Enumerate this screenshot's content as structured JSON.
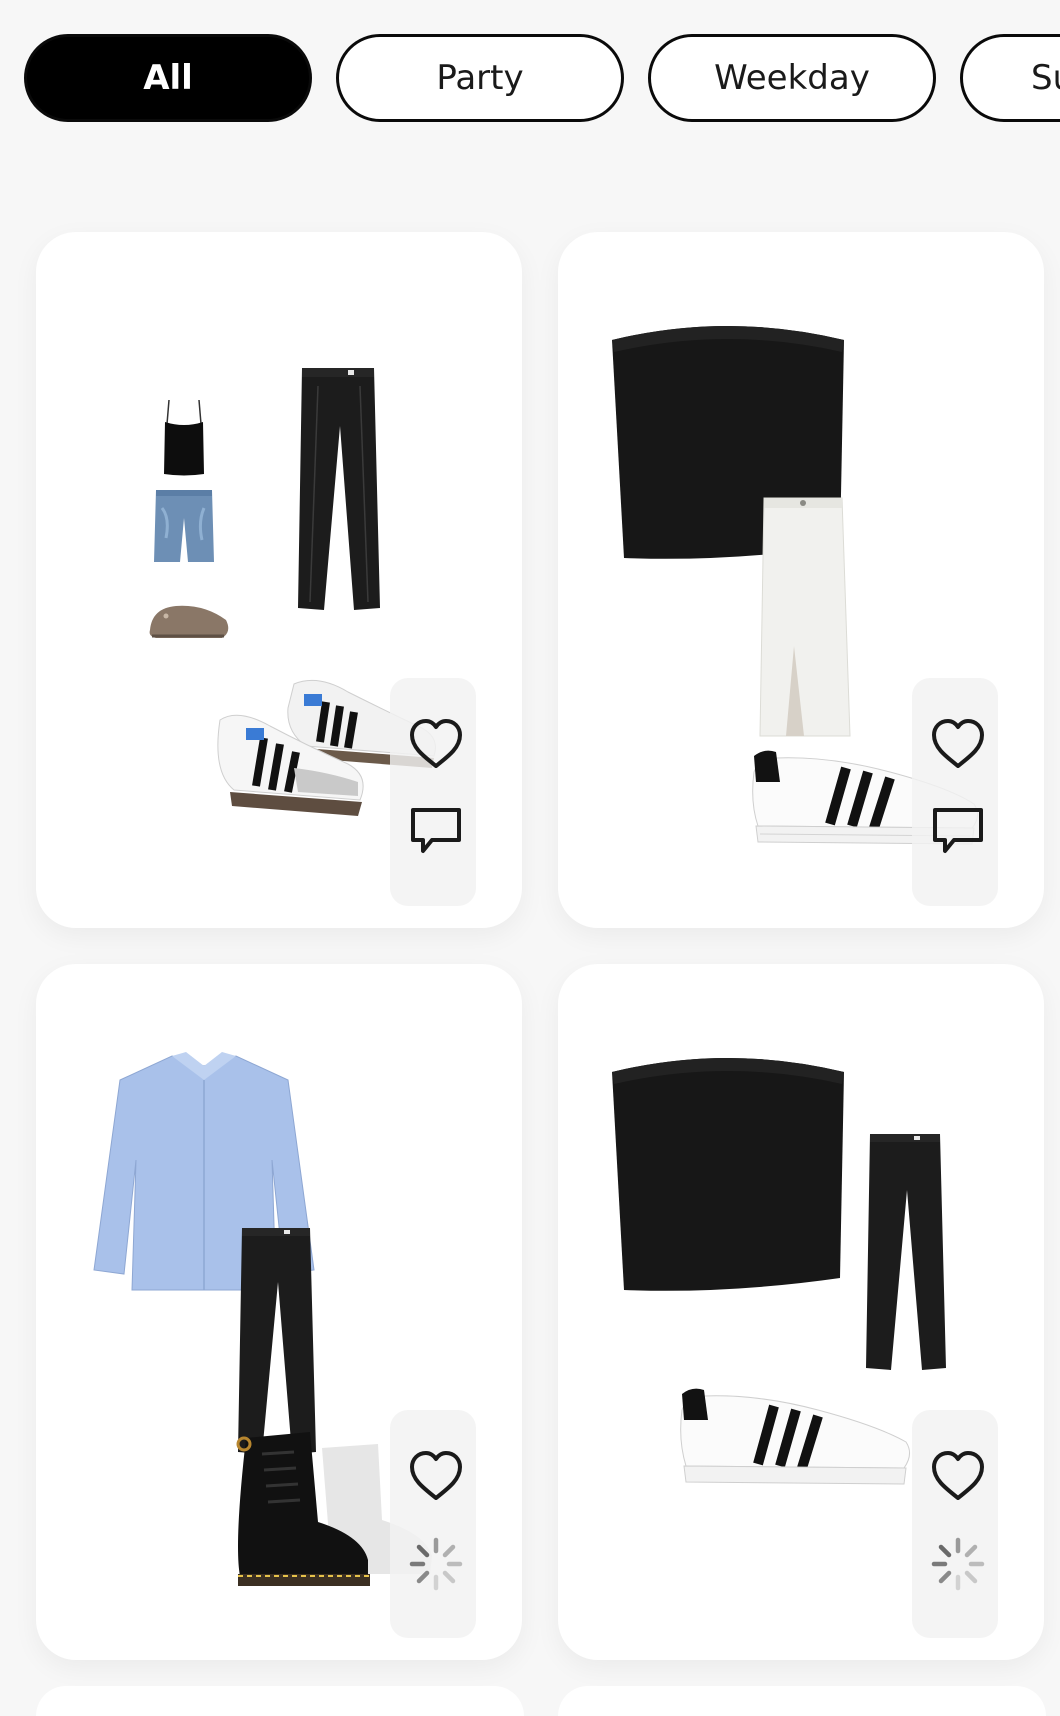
{
  "filters": {
    "items": [
      {
        "label": "All",
        "active": true
      },
      {
        "label": "Party",
        "active": false
      },
      {
        "label": "Weekday",
        "active": false
      },
      {
        "label": "Su",
        "active": false
      }
    ]
  },
  "outfits": [
    {
      "items": [
        "black cami top",
        "denim shorts",
        "suede clogs",
        "black trousers",
        "samba sneakers"
      ],
      "actions": [
        "heart-icon",
        "comment-icon"
      ]
    },
    {
      "items": [
        "black tube top",
        "white denim maxi skirt",
        "superstar sneakers"
      ],
      "actions": [
        "heart-icon",
        "comment-icon"
      ]
    },
    {
      "items": [
        "light blue oversized shirt",
        "black trousers",
        "black combat boots"
      ],
      "actions": [
        "heart-icon",
        "loading-spinner-icon"
      ]
    },
    {
      "items": [
        "black tube top",
        "black trousers",
        "superstar sneakers"
      ],
      "actions": [
        "heart-icon",
        "loading-spinner-icon"
      ]
    }
  ],
  "colors": {
    "active_chip": "#000000",
    "chip_border": "#0a0a0a",
    "background": "#f7f7f7",
    "card": "#ffffff"
  }
}
